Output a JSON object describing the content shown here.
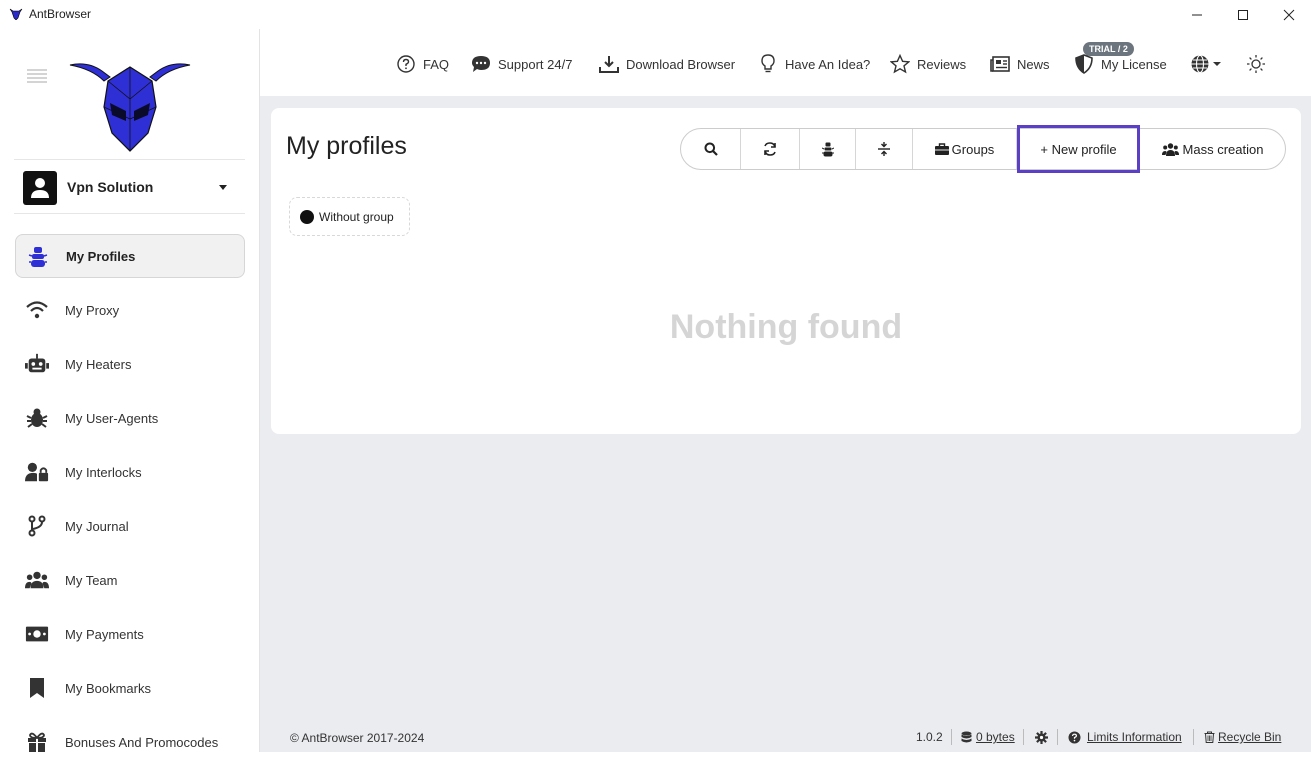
{
  "window": {
    "title": "AntBrowser",
    "controls": [
      "minimize-icon",
      "maximize-icon",
      "close-icon"
    ]
  },
  "sidebar": {
    "account": {
      "name": "Vpn Solution"
    },
    "items": [
      {
        "label": "My Profiles",
        "icon": "ant-icon",
        "active": true
      },
      {
        "label": "My Proxy",
        "icon": "wifi-icon"
      },
      {
        "label": "My Heaters",
        "icon": "robot-icon"
      },
      {
        "label": "My User-Agents",
        "icon": "bug-icon"
      },
      {
        "label": "My Interlocks",
        "icon": "user-lock-icon"
      },
      {
        "label": "My Journal",
        "icon": "code-branch-icon"
      },
      {
        "label": "My Team",
        "icon": "users-icon"
      },
      {
        "label": "My Payments",
        "icon": "money-bill-icon"
      },
      {
        "label": "My Bookmarks",
        "icon": "bookmark-icon"
      },
      {
        "label": "Bonuses And Promocodes",
        "icon": "gift-icon"
      }
    ]
  },
  "topnav": {
    "faq": "FAQ",
    "support": "Support 24/7",
    "download": "Download Browser",
    "idea": "Have An Idea?",
    "reviews": "Reviews",
    "news": "News",
    "license": "My License",
    "trial_badge": "TRIAL / 2"
  },
  "profiles": {
    "title": "My profiles",
    "toolbar": {
      "groups": "Groups",
      "new_profile": "+ New profile",
      "mass_creation": "Mass creation"
    },
    "group_chip": "Without group",
    "empty_text": "Nothing found"
  },
  "footer": {
    "copyright": "© AntBrowser 2017-2024",
    "version": "1.0.2",
    "storage": "0 bytes",
    "limits": "Limits Information",
    "recycle": "Recycle Bin"
  },
  "colors": {
    "accent_highlight": "#5b3fc4",
    "logo_blue": "#2f2fd6",
    "background": "#ebecf0"
  }
}
